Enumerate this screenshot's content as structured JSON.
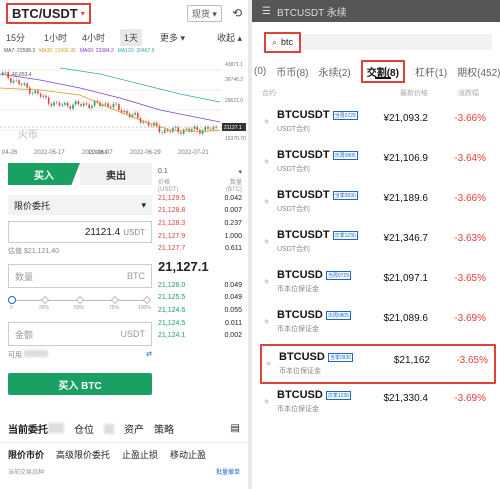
{
  "left": {
    "pair": "BTC/USDT",
    "spot_label": "现货",
    "timeframes": [
      "15分",
      "1小时",
      "4小时",
      "1天"
    ],
    "more": "更多",
    "collapse": "收起",
    "ma": [
      "MA7: 22598.3",
      "MA30: 21006.35",
      "MA60: 23384.2",
      "MA120: 30467.9"
    ],
    "chart_labels": {
      "high": "40,653.4",
      "low": "17,618.0",
      "watermark": "火币",
      "right_ticks": [
        "43871.1",
        "36746.2",
        "29621.0",
        "21127.1",
        "15370.70"
      ],
      "dates": [
        "04-26",
        "2022-05-17",
        "2022-06-07",
        "2022-06-29",
        "2022-07-21"
      ]
    },
    "chart_data": {
      "type": "line",
      "title": "",
      "x": [
        "04-26",
        "2022-05-17",
        "2022-06-07",
        "2022-06-29",
        "2022-07-21"
      ],
      "series": [
        {
          "name": "",
          "values": [
            40653.4,
            29600,
            29900,
            20400,
            21127.1
          ]
        }
      ],
      "ylim": [
        15370.7,
        43871.1
      ]
    },
    "form": {
      "buy_tab": "买入",
      "sell_tab": "卖出",
      "order_type": "限价委托",
      "price_value": "21121.4",
      "price_unit": "USDT",
      "estimate": "估值 $21,121.40",
      "qty_placeholder": "数量",
      "qty_unit": "BTC",
      "slider_labels": [
        "0",
        "25%",
        "50%",
        "75%",
        "100%"
      ],
      "amount_placeholder": "金额",
      "amount_unit": "USDT",
      "available": "可用",
      "buy_button": "买入 BTC"
    },
    "book": {
      "depth": "0.1",
      "col_price": "价格 (USDT)",
      "col_qty": "数量 (BTC)",
      "asks": [
        [
          "21,129.5",
          "0.042"
        ],
        [
          "21,128.8",
          "0.007"
        ],
        [
          "21,128.3",
          "0.237"
        ],
        [
          "21,127.9",
          "1.000"
        ],
        [
          "21,127.7",
          "0.611"
        ]
      ],
      "mid": "21,127.1",
      "bids": [
        [
          "21,126.0",
          "0.049"
        ],
        [
          "21,125.5",
          "0.049"
        ],
        [
          "21,124.6",
          "0.055"
        ],
        [
          "21,124.5",
          "0.011"
        ],
        [
          "21,124.1",
          "0.002"
        ]
      ]
    },
    "bottom": {
      "tabs": [
        "当前委托",
        "仓位",
        "资产",
        "策略"
      ],
      "sub": [
        "限价市价",
        "高级限价委托",
        "止盈止损",
        "移动止盈"
      ],
      "foot_left": "当前交易品种",
      "foot_right": "批量撤单"
    }
  },
  "right": {
    "dim_title": "BTCUSDT 永续",
    "search_value": "btc",
    "tabs": [
      "(0)",
      "币币(8)",
      "永续(2)",
      "交割(8)",
      "杠杆(1)",
      "期权(452)"
    ],
    "col_symbol": "合约",
    "col_price": "最新价格",
    "col_change": "涨跌幅",
    "rows": [
      {
        "sym": "BTCUSDT",
        "tag": "当周0729",
        "sub": "USDT合约",
        "price": "¥21,093.2",
        "chg": "-3.66%"
      },
      {
        "sym": "BTCUSDT",
        "tag": "次周0805",
        "sub": "USDT合约",
        "price": "¥21,106.9",
        "chg": "-3.64%"
      },
      {
        "sym": "BTCUSDT",
        "tag": "当季0930",
        "sub": "USDT合约",
        "price": "¥21,189.6",
        "chg": "-3.66%"
      },
      {
        "sym": "BTCUSDT",
        "tag": "次季1230",
        "sub": "USDT合约",
        "price": "¥21,346.7",
        "chg": "-3.63%"
      },
      {
        "sym": "BTCUSD",
        "tag": "当周0729",
        "sub": "币本位保证金",
        "price": "$21,097.1",
        "chg": "-3.65%"
      },
      {
        "sym": "BTCUSD",
        "tag": "次周0805",
        "sub": "币本位保证金",
        "price": "$21,089.6",
        "chg": "-3.69%"
      },
      {
        "sym": "BTCUSD",
        "tag": "当季0930",
        "sub": "币本位保证金",
        "price": "$21,162",
        "chg": "-3.65%"
      },
      {
        "sym": "BTCUSD",
        "tag": "次季1230",
        "sub": "币本位保证金",
        "price": "$21,330.4",
        "chg": "-3.69%"
      }
    ]
  }
}
